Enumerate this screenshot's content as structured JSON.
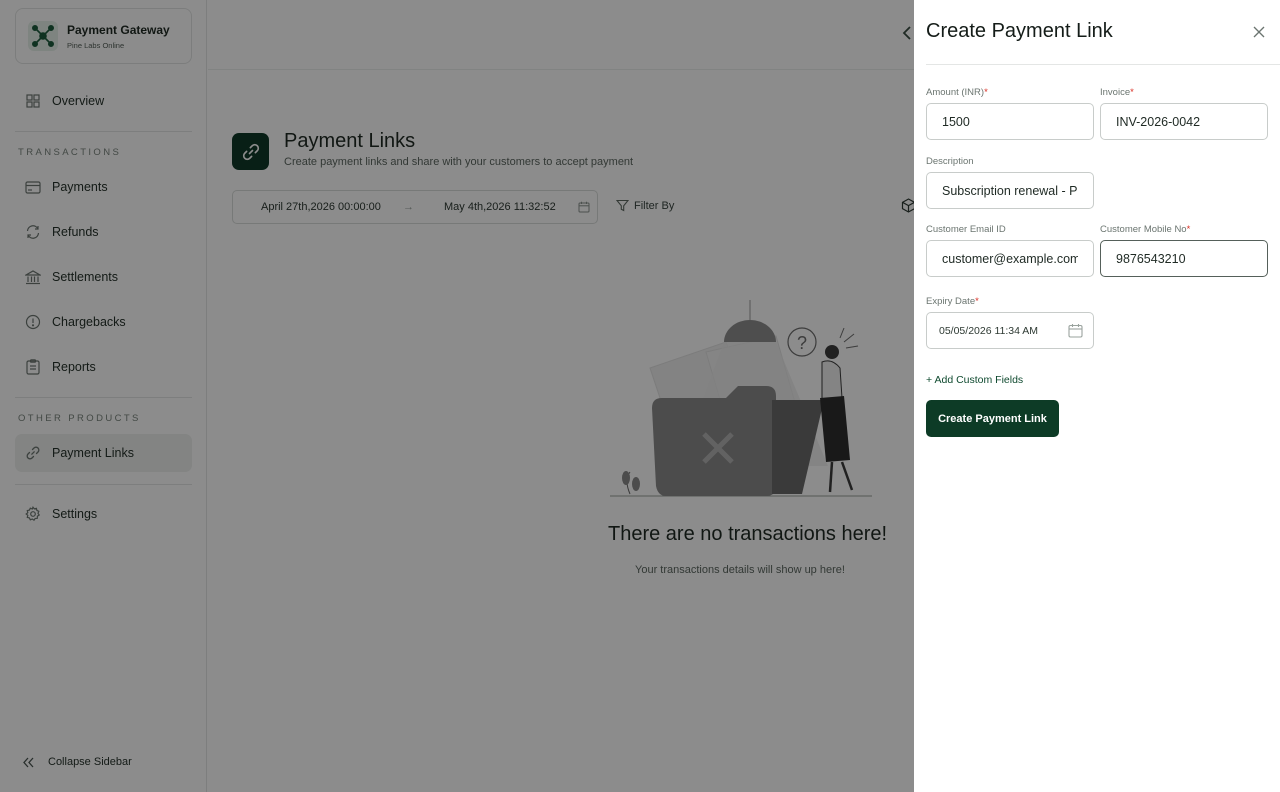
{
  "brand": {
    "name": "Payment Gateway",
    "subtitle": "Pine Labs Online"
  },
  "sidebar": {
    "overview": "Overview",
    "section_transactions": "TRANSACTIONS",
    "items": [
      {
        "label": "Payments",
        "icon": "credit-card-icon"
      },
      {
        "label": "Refunds",
        "icon": "refresh-icon"
      },
      {
        "label": "Settlements",
        "icon": "bank-icon"
      },
      {
        "label": "Chargebacks",
        "icon": "alert-circle-icon"
      },
      {
        "label": "Reports",
        "icon": "document-icon"
      }
    ],
    "section_other": "OTHER PRODUCTS",
    "payment_links": "Payment Links",
    "settings": "Settings",
    "collapse": "Collapse Sidebar"
  },
  "main": {
    "title": "Payment Links",
    "subtitle": "Create payment links and share with your customers to accept payment",
    "date_start": "April 27th,2026 00:00:00",
    "date_arrow": "→",
    "date_end": "May 4th,2026 11:32:52",
    "filter_label": "Filter By",
    "empty_title": "There are no transactions here!",
    "empty_subtitle": "Your transactions details will show up here!"
  },
  "drawer": {
    "title": "Create Payment Link",
    "required_mark": "*",
    "amount": {
      "label": "Amount (INR)",
      "value": "1500"
    },
    "invoice": {
      "label": "Invoice",
      "value": "INV-2026-0042"
    },
    "description": {
      "label": "Description",
      "value": "Subscription renewal - Pr"
    },
    "email": {
      "label": "Customer Email ID",
      "value": "customer@example.com"
    },
    "mobile": {
      "label": "Customer Mobile No",
      "value": "9876543210"
    },
    "expiry": {
      "label": "Expiry Date",
      "value": "05/05/2026 11:34 AM"
    },
    "add_custom": "+ Add Custom Fields",
    "submit": "Create Payment Link"
  },
  "colors": {
    "brand_dark_green": "#0d3b26",
    "required_red": "#d93025",
    "overlay": "rgba(0,0,0,0.45)"
  }
}
